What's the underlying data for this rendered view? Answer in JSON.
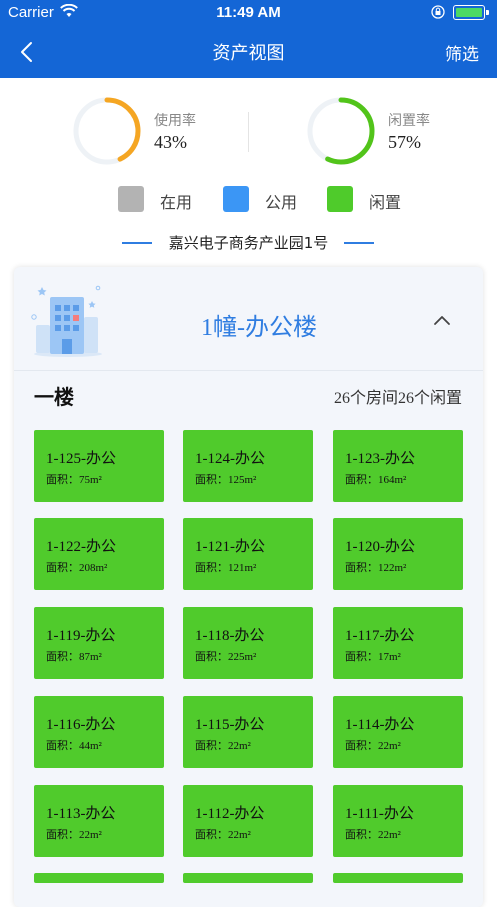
{
  "status_bar": {
    "carrier": "Carrier",
    "time": "11:49 AM",
    "battery_color": "#4cd964"
  },
  "nav": {
    "title": "资产视图",
    "filter_label": "筛选",
    "back_icon": "chevron-left-icon",
    "background": "#1466d6"
  },
  "stats": {
    "usage": {
      "label": "使用率",
      "value": "43%",
      "fraction": 0.43,
      "color": "#f5a623"
    },
    "idle": {
      "label": "闲置率",
      "value": "57%",
      "fraction": 0.57,
      "color": "#52c41a"
    }
  },
  "legend": [
    {
      "label": "在用",
      "color": "#b3b3b3"
    },
    {
      "label": "公用",
      "color": "#3b96f5"
    },
    {
      "label": "闲置",
      "color": "#4fcb2b"
    }
  ],
  "park_name": "嘉兴电子商务产业园1号",
  "building": {
    "title": "1幢-办公楼",
    "icon": "office-building-icon",
    "expanded": true,
    "floors": [
      {
        "name": "一楼",
        "summary": "26个房间26个闲置",
        "rooms": [
          {
            "name": "1-125-办公",
            "area": "面积：75m²"
          },
          {
            "name": "1-124-办公",
            "area": "面积：125m²"
          },
          {
            "name": "1-123-办公",
            "area": "面积：164m²"
          },
          {
            "name": "1-122-办公",
            "area": "面积：208m²"
          },
          {
            "name": "1-121-办公",
            "area": "面积：121m²"
          },
          {
            "name": "1-120-办公",
            "area": "面积：122m²"
          },
          {
            "name": "1-119-办公",
            "area": "面积：87m²"
          },
          {
            "name": "1-118-办公",
            "area": "面积：225m²"
          },
          {
            "name": "1-117-办公",
            "area": "面积：17m²"
          },
          {
            "name": "1-116-办公",
            "area": "面积：44m²"
          },
          {
            "name": "1-115-办公",
            "area": "面积：22m²"
          },
          {
            "name": "1-114-办公",
            "area": "面积：22m²"
          },
          {
            "name": "1-113-办公",
            "area": "面积：22m²"
          },
          {
            "name": "1-112-办公",
            "area": "面积：22m²"
          },
          {
            "name": "1-111-办公",
            "area": "面积：22m²"
          }
        ]
      }
    ]
  }
}
